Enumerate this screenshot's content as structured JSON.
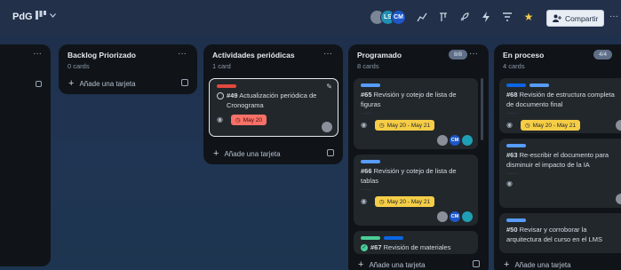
{
  "topbar": {
    "board_title": "PdG",
    "member_initials": [
      "",
      "LS",
      "CM"
    ],
    "share_label": "Compartir"
  },
  "colors": {
    "red": "#e2483d",
    "blue": "#579dff",
    "dark_blue": "#0c66e4",
    "green": "#4bce97",
    "purple_faint": "#6d4b8f",
    "date_yellow": "#f5cd47",
    "date_red": "#f87168",
    "wip_badge": "#5f6f88"
  },
  "columns": [
    {
      "title": "",
      "count": "",
      "add_label": ""
    },
    {
      "title": "Backlog Priorizado",
      "count": "0 cards",
      "add_label": "Añade una tarjeta"
    },
    {
      "title": "Actividades periódicas",
      "count": "1 card",
      "add_label": "Añade una tarjeta"
    },
    {
      "title": "Programado",
      "count": "8 cards",
      "wip": "8/8",
      "add_label": "Añade una tarjeta"
    },
    {
      "title": "En proceso",
      "count": "4 cards",
      "wip": "4/4",
      "add_label": "Añade una tarjeta"
    }
  ],
  "cards": {
    "c49": {
      "number": "#49",
      "title": "Actualización periódica de Cronograma",
      "date": "May 20"
    },
    "c65": {
      "number": "#65",
      "title": "Revisión y cotejo de lista de figuras",
      "faint": "······",
      "date": "May 20 - May 21",
      "members": [
        "",
        "CM",
        ""
      ]
    },
    "c66": {
      "number": "#66",
      "title": "Revisión y cotejo de lista de tablas",
      "faint": "······",
      "date": "May 20 - May 21",
      "members": [
        "",
        "CM",
        ""
      ]
    },
    "c67": {
      "number": "#67",
      "title": "Revisión de materiales"
    },
    "c68": {
      "number": "#68",
      "title": "Revisión de estructura completa de documento final",
      "faint": "······",
      "date": "May 20 - May 21"
    },
    "c63": {
      "number": "#63",
      "title": "Re-escribir el documento para disminuir el impacto de la IA",
      "faint": "······"
    },
    "c50": {
      "number": "#50",
      "title": "Revisar y corroborar la arquitectura del curso en el LMS"
    }
  }
}
